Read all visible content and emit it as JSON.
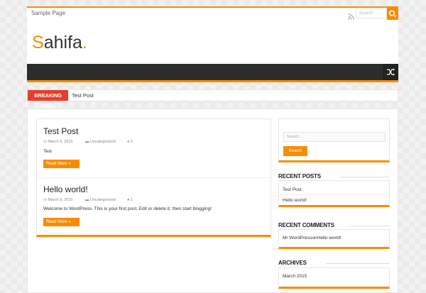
{
  "topbar": {
    "menu_item": "Sample Page",
    "search_placeholder": "Search",
    "icons": [
      "rss-icon",
      "search-icon"
    ],
    "accent_color": "#f88c00"
  },
  "header": {
    "logo_first": "S",
    "logo_rest": "ahifa",
    "logo_dot": "."
  },
  "nav": {
    "icon": "random-icon"
  },
  "breaking": {
    "label": "BREAKING NEWS",
    "text": "Test Post",
    "label_color": "#e73e2c"
  },
  "posts": [
    {
      "title": "Test Post",
      "date": "March 9, 2015",
      "category": "Uncategorized",
      "comments": "0",
      "excerpt": "Test",
      "more": "Read More »"
    },
    {
      "title": "Hello world!",
      "date": "March 9, 2015",
      "category": "Uncategorized",
      "comments": "1",
      "excerpt": "Welcome to WordPress. This is your first post. Edit or delete it, then start blogging!",
      "more": "Read More »"
    }
  ],
  "sidebar": {
    "search_placeholder": "Search ...",
    "search_button": "Search",
    "recent_posts_title": "RECENT POSTS",
    "recent_posts": [
      "Test Post",
      "Hello world!"
    ],
    "recent_comments_title": "RECENT COMMENTS",
    "recent_comment": {
      "author": "Mr WordPress",
      "on": "on",
      "post": "Hello world!"
    },
    "archives_title": "ARCHIVES",
    "archives": [
      "March 2015"
    ]
  }
}
